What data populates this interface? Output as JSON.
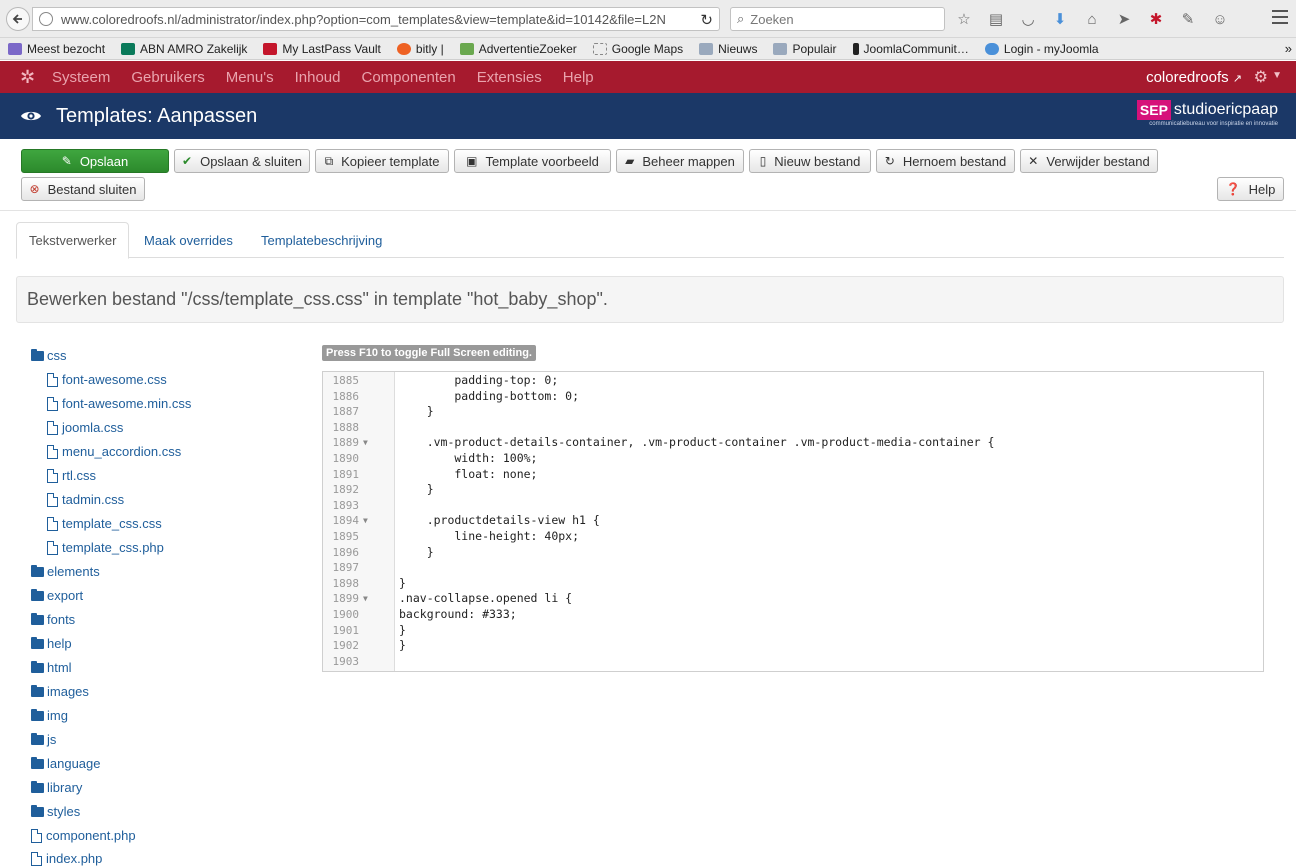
{
  "browser": {
    "url": "www.coloredroofs.nl/administrator/index.php?option=com_templates&view=template&id=10142&file=L2N",
    "search_placeholder": "Zoeken",
    "bookmarks": [
      {
        "label": "Meest bezocht",
        "color": "#7b68c8"
      },
      {
        "label": "ABN AMRO Zakelijk",
        "color": "#0a7a5a"
      },
      {
        "label": "My LastPass Vault",
        "color": "#c4162b"
      },
      {
        "label": "bitly |",
        "color": "#ee6123"
      },
      {
        "label": "AdvertentieZoeker",
        "color": "#6aa84f"
      },
      {
        "label": "Google Maps",
        "color": "#888888"
      },
      {
        "label": "Nieuws",
        "color": "#9aa9bd"
      },
      {
        "label": "Populair",
        "color": "#9aa9bd"
      },
      {
        "label": "JoomlaCommunit…",
        "color": "#222222"
      },
      {
        "label": "Login - myJoomla",
        "color": "#4a90d9"
      }
    ],
    "bookmarks_more": "»"
  },
  "topmenu": {
    "items": [
      "Systeem",
      "Gebruikers",
      "Menu's",
      "Inhoud",
      "Componenten",
      "Extensies",
      "Help"
    ],
    "site_name": "coloredroofs"
  },
  "header": {
    "title": "Templates: Aanpassen",
    "logo_mark": "SEP",
    "logo_brand": "studioericpaap",
    "logo_tagline": "communicatiebureau voor inspiratie en innovatie"
  },
  "toolbar": {
    "save": "Opslaan",
    "save_close": "Opslaan & sluiten",
    "copy_template": "Kopieer template",
    "preview": "Template voorbeeld",
    "manage_folders": "Beheer mappen",
    "new_file": "Nieuw bestand",
    "rename_file": "Hernoem bestand",
    "delete_file": "Verwijder bestand",
    "close_file": "Bestand sluiten",
    "help": "Help"
  },
  "tabs": [
    "Tekstverwerker",
    "Maak overrides",
    "Templatebeschrijving"
  ],
  "editing_message": "Bewerken bestand \"/css/template_css.css\" in template \"hot_baby_shop\".",
  "tree": {
    "root_folder": "css",
    "css_files": [
      "font-awesome.css",
      "font-awesome.min.css",
      "joomla.css",
      "menu_accordion.css",
      "rtl.css",
      "tadmin.css",
      "template_css.css",
      "template_css.php"
    ],
    "folders": [
      "elements",
      "export",
      "fonts",
      "help",
      "html",
      "images",
      "img",
      "js",
      "language",
      "library",
      "styles"
    ],
    "files": [
      "component.php",
      "index.php"
    ]
  },
  "editor": {
    "fullscreen_hint": "Press F10 to toggle Full Screen editing.",
    "lines": [
      {
        "n": "1885",
        "fold": "",
        "code": "        padding-top: 0;"
      },
      {
        "n": "1886",
        "fold": "",
        "code": "        padding-bottom: 0;"
      },
      {
        "n": "1887",
        "fold": "",
        "code": "    }"
      },
      {
        "n": "1888",
        "fold": "",
        "code": ""
      },
      {
        "n": "1889",
        "fold": "▼",
        "code": "    .vm-product-details-container, .vm-product-container .vm-product-media-container {"
      },
      {
        "n": "1890",
        "fold": "",
        "code": "        width: 100%;"
      },
      {
        "n": "1891",
        "fold": "",
        "code": "        float: none;"
      },
      {
        "n": "1892",
        "fold": "",
        "code": "    }"
      },
      {
        "n": "1893",
        "fold": "",
        "code": ""
      },
      {
        "n": "1894",
        "fold": "▼",
        "code": "    .productdetails-view h1 {"
      },
      {
        "n": "1895",
        "fold": "",
        "code": "        line-height: 40px;"
      },
      {
        "n": "1896",
        "fold": "",
        "code": "    }"
      },
      {
        "n": "1897",
        "fold": "",
        "code": ""
      },
      {
        "n": "1898",
        "fold": "",
        "code": "}"
      },
      {
        "n": "1899",
        "fold": "▼",
        "code": ".nav-collapse.opened li {"
      },
      {
        "n": "1900",
        "fold": "",
        "code": "background: #333;"
      },
      {
        "n": "1901",
        "fold": "",
        "code": "}"
      },
      {
        "n": "1902",
        "fold": "",
        "code": "}"
      },
      {
        "n": "1903",
        "fold": "",
        "code": ""
      }
    ]
  },
  "colors": {
    "joomla_menu": "#a61a2e",
    "header_bg": "#1b3867",
    "success": "#2c8a2c",
    "link": "#1f5e9b"
  }
}
